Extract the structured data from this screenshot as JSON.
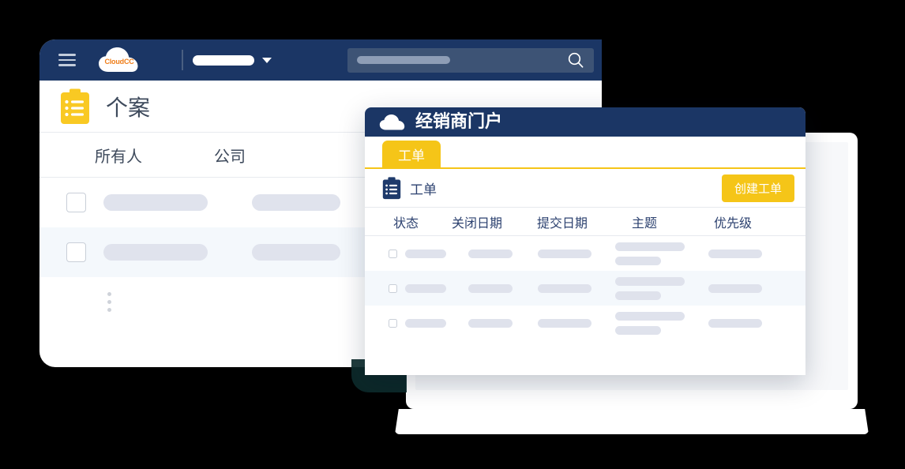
{
  "app_window": {
    "header": {
      "menu_icon": "hamburger-menu-icon",
      "logo_text": "CloudCC",
      "logo_icon": "cloud-logo-icon",
      "org_select_value": "",
      "caret_icon": "chevron-down-icon",
      "search": {
        "placeholder": "",
        "value": "",
        "icon": "search-icon"
      },
      "icons": [
        "bell-icon",
        "plus-icon",
        "gear-icon"
      ],
      "avatar": "user-avatar"
    },
    "page": {
      "title": "个案",
      "title_icon": "clipboard-icon"
    },
    "table": {
      "columns": [
        "所有人",
        "公司"
      ],
      "rows": [
        {
          "checked": false,
          "cells": [
            "",
            ""
          ]
        },
        {
          "checked": false,
          "cells": [
            "",
            ""
          ]
        }
      ]
    },
    "footer": {
      "more_icon": "more-vertical-icon"
    }
  },
  "portal_dialog": {
    "header": {
      "title": "经销商门户",
      "icon": "cloud-icon"
    },
    "tabs": [
      {
        "label": "工单",
        "active": true
      }
    ],
    "section": {
      "title": "工单",
      "icon": "clipboard-icon",
      "create_button": "创建工单"
    },
    "table": {
      "columns": [
        "状态",
        "关闭日期",
        "提交日期",
        "主题",
        "优先级"
      ],
      "rows": [
        {
          "checked": false,
          "highlighted": false,
          "cells": [
            "",
            "",
            "",
            "",
            ""
          ]
        },
        {
          "checked": false,
          "highlighted": true,
          "cells": [
            "",
            "",
            "",
            "",
            ""
          ]
        },
        {
          "checked": false,
          "highlighted": false,
          "cells": [
            "",
            "",
            "",
            "",
            ""
          ]
        }
      ]
    }
  },
  "colors": {
    "navy": "#1b3665",
    "yellow": "#f5c518",
    "orange": "#ef7d18",
    "skeleton": "#dfe2ec",
    "row_highlight": "#f4f8fc",
    "background": "#000000"
  }
}
